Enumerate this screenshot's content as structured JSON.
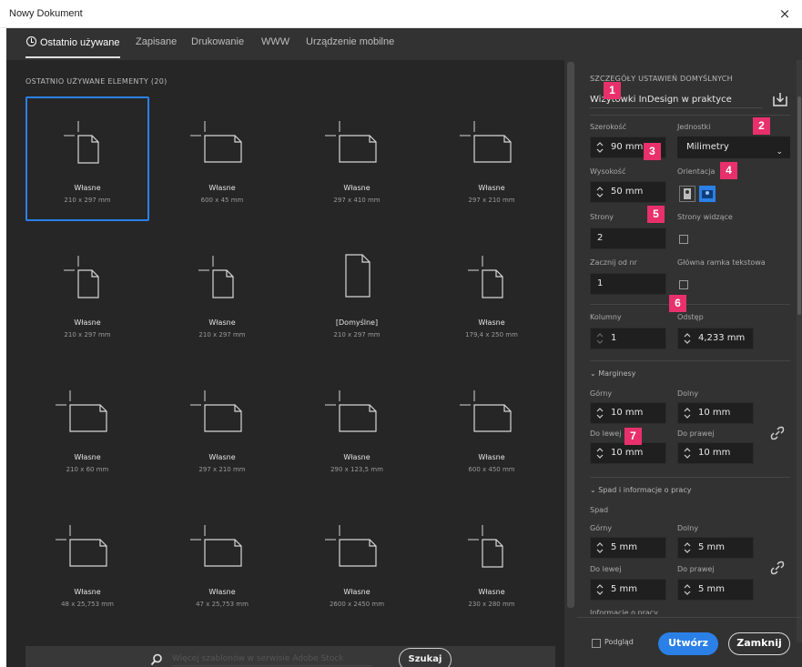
{
  "window": {
    "title": "Nowy Dokument",
    "close_glyph": "×"
  },
  "tabs": [
    {
      "label": "Ostatnio używane",
      "active": true
    },
    {
      "label": "Zapisane"
    },
    {
      "label": "Drukowanie"
    },
    {
      "label": "WWW"
    },
    {
      "label": "Urządzenie mobilne"
    }
  ],
  "recent": {
    "heading": "OSTATNIO UŻYWANE ELEMENTY  (20)",
    "items": [
      {
        "name": "Własne",
        "size": "210 x 297 mm",
        "orient": "portrait",
        "selected": true
      },
      {
        "name": "Własne",
        "size": "600 x 45 mm",
        "orient": "landscape"
      },
      {
        "name": "Własne",
        "size": "297 x 410 mm",
        "orient": "landscape"
      },
      {
        "name": "Własne",
        "size": "297 x 210 mm",
        "orient": "landscape"
      },
      {
        "name": "Własne",
        "size": "210 x 297 mm",
        "orient": "portrait"
      },
      {
        "name": "Własne",
        "size": "210 x 297 mm",
        "orient": "portrait"
      },
      {
        "name": "[Domyślne]",
        "size": "210 x 297 mm",
        "orient": "plain"
      },
      {
        "name": "Własne",
        "size": "179,4 x 250 mm",
        "orient": "portrait"
      },
      {
        "name": "Własne",
        "size": "210 x 60 mm",
        "orient": "landscape"
      },
      {
        "name": "Własne",
        "size": "297 x 210 mm",
        "orient": "landscape"
      },
      {
        "name": "Własne",
        "size": "290 x 123,5 mm",
        "orient": "landscape"
      },
      {
        "name": "Własne",
        "size": "600 x 450 mm",
        "orient": "landscape"
      },
      {
        "name": "Własne",
        "size": "48 x 25,753 mm",
        "orient": "landscape"
      },
      {
        "name": "Własne",
        "size": "47 x 25,753 mm",
        "orient": "landscape"
      },
      {
        "name": "Własne",
        "size": "2600 x 2450 mm",
        "orient": "landscape"
      },
      {
        "name": "Własne",
        "size": "230 x 280 mm",
        "orient": "portrait"
      }
    ]
  },
  "search": {
    "placeholder": "Więcej szablonów w serwisie Adobe Stock",
    "button": "Szukaj"
  },
  "settings": {
    "heading": "SZCZEGÓŁY USTAWIEŃ DOMYŚLNYCH",
    "preset_name": "Wizytówki InDesign w praktyce",
    "width_label": "Szerokość",
    "width_value": "90 mm",
    "units_label": "Jednostki",
    "units_value": "Milimetry",
    "height_label": "Wysokość",
    "height_value": "50 mm",
    "orientation_label": "Orientacja",
    "pages_label": "Strony",
    "pages_value": "2",
    "facing_label": "Strony widzące",
    "start_label": "Zacznij od nr",
    "start_value": "1",
    "primary_frame_label": "Główna ramka tekstowa",
    "columns_label": "Kolumny",
    "columns_value": "1",
    "gutter_label": "Odstęp",
    "gutter_value": "4,233 mm",
    "margins_heading": "Marginesy",
    "top_label": "Górny",
    "top_value": "10 mm",
    "bottom_label": "Dolny",
    "bottom_value": "10 mm",
    "left_label": "Do lewej",
    "left_value": "10 mm",
    "right_label": "Do prawej",
    "right_value": "10 mm",
    "bleed_heading": "Spad i informacje o pracy",
    "bleed_label": "Spad",
    "bleed_top_label": "Górny",
    "bleed_top_value": "5 mm",
    "bleed_bottom_label": "Dolny",
    "bleed_bottom_value": "5 mm",
    "bleed_left_label": "Do lewej",
    "bleed_left_value": "5 mm",
    "bleed_right_label": "Do prawej",
    "bleed_right_value": "5 mm",
    "slug_label": "Informacje o pracy"
  },
  "footer": {
    "preview_label": "Podgląd",
    "create_button": "Utwórz",
    "close_button": "Zamknij"
  },
  "badges": [
    "1",
    "2",
    "3",
    "4",
    "5",
    "6",
    "7"
  ],
  "colors": {
    "accent": "#2b80e8",
    "badge": "#e8306d"
  }
}
